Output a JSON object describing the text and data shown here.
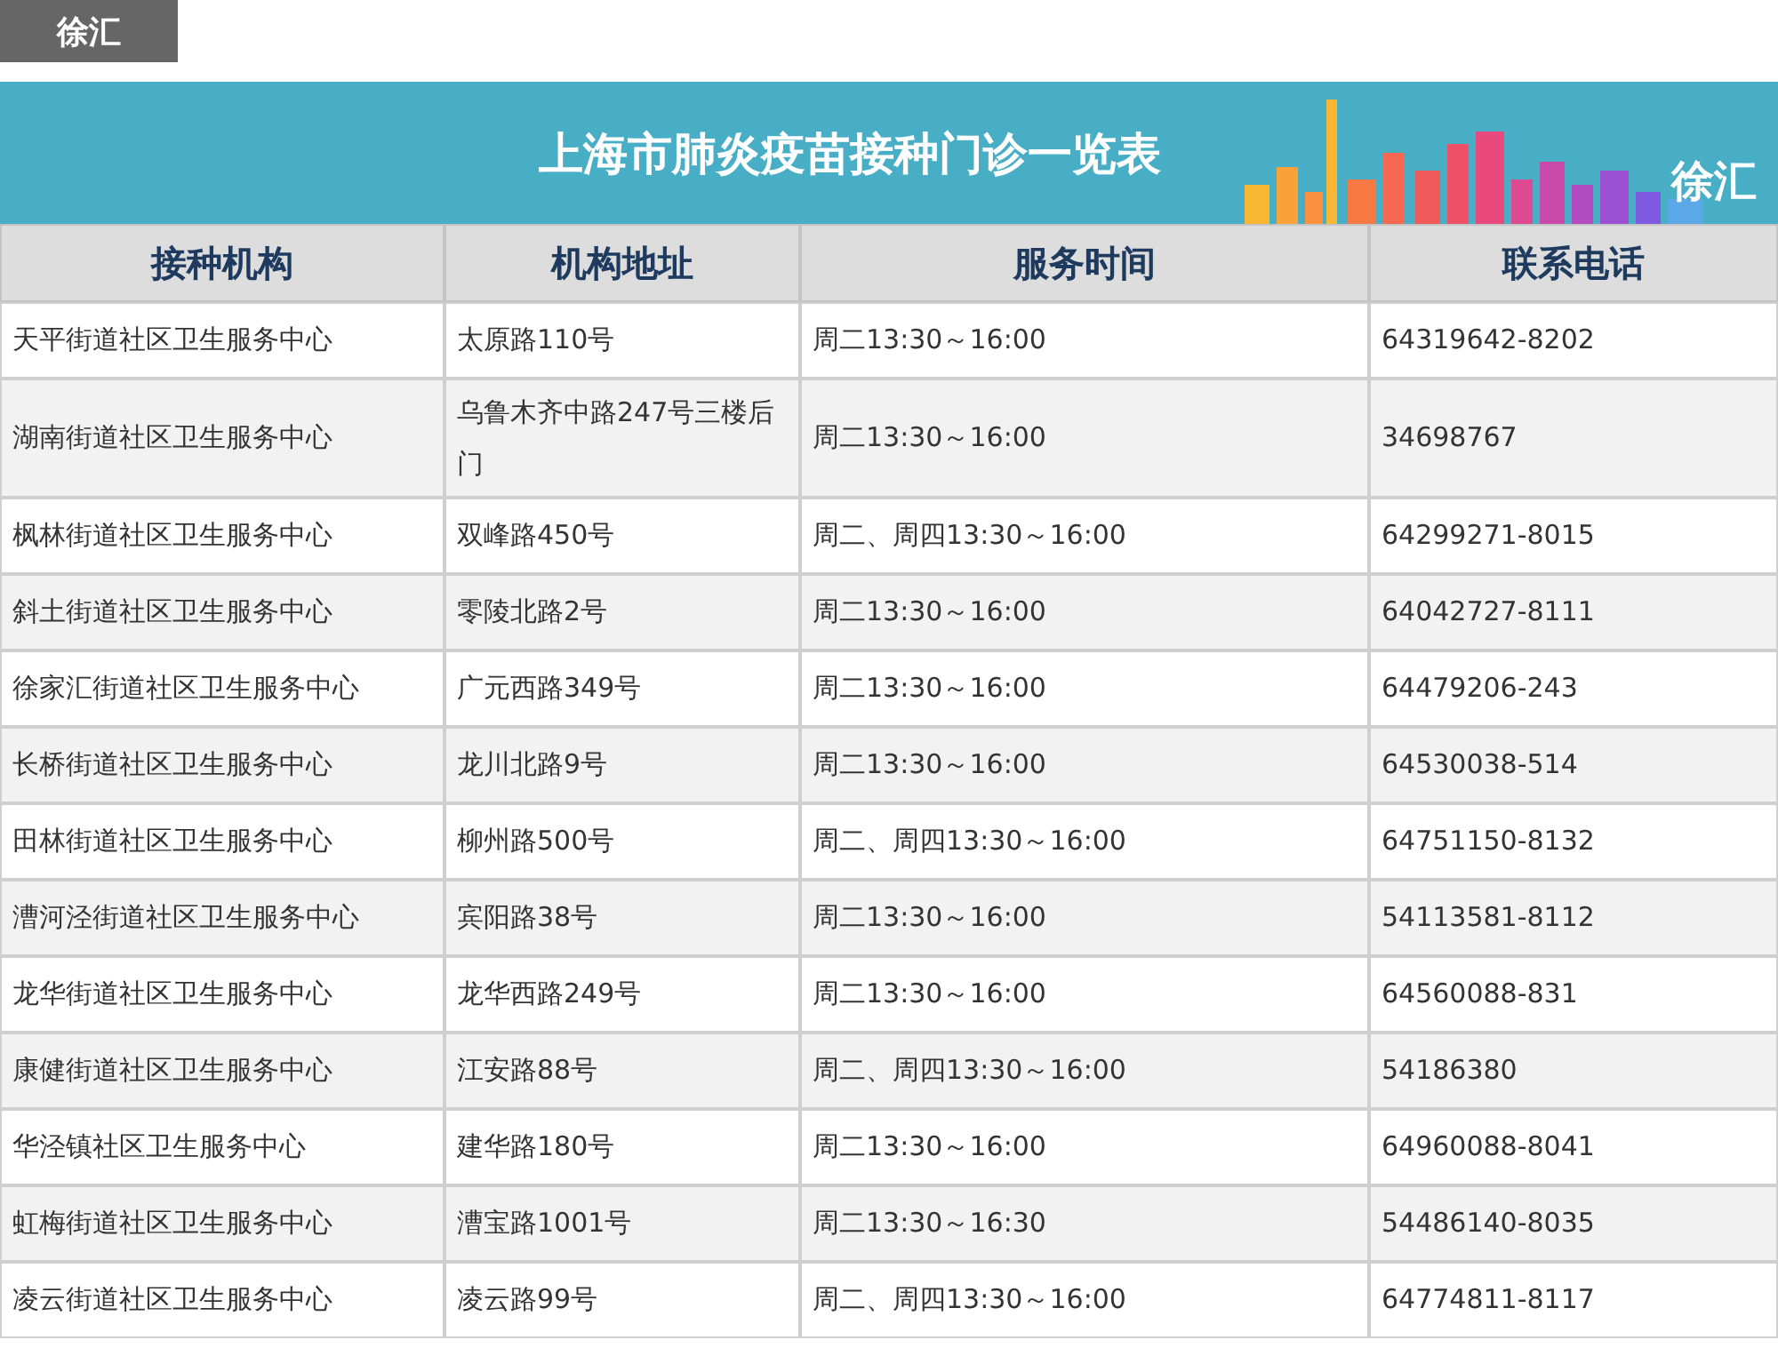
{
  "district_tab": {
    "label": "徐汇",
    "selected": true
  },
  "banner": {
    "title": "上海市肺炎疫苗接种门诊一览表",
    "district": "徐汇"
  },
  "table": {
    "columns": [
      "接种机构",
      "机构地址",
      "服务时间",
      "联系电话"
    ],
    "rows": [
      [
        "天平街道社区卫生服务中心",
        "太原路110号",
        "周二13:30～16:00",
        "64319642-8202"
      ],
      [
        "湖南街道社区卫生服务中心",
        "乌鲁木齐中路247号三楼后门",
        "周二13:30～16:00",
        "34698767"
      ],
      [
        "枫林街道社区卫生服务中心",
        "双峰路450号",
        "周二、周四13:30～16:00",
        "64299271-8015"
      ],
      [
        "斜土街道社区卫生服务中心",
        "零陵北路2号",
        "周二13:30～16:00",
        "64042727-8111"
      ],
      [
        "徐家汇街道社区卫生服务中心",
        "广元西路349号",
        "周二13:30～16:00",
        "64479206-243"
      ],
      [
        "长桥街道社区卫生服务中心",
        "龙川北路9号",
        "周二13:30～16:00",
        "64530038-514"
      ],
      [
        "田林街道社区卫生服务中心",
        "柳州路500号",
        "周二、周四13:30～16:00",
        "64751150-8132"
      ],
      [
        "漕河泾街道社区卫生服务中心",
        "宾阳路38号",
        "周二13:30～16:00",
        "54113581-8112"
      ],
      [
        "龙华街道社区卫生服务中心",
        "龙华西路249号",
        "周二13:30～16:00",
        "64560088-831"
      ],
      [
        "康健街道社区卫生服务中心",
        "江安路88号",
        "周二、周四13:30～16:00",
        "54186380"
      ],
      [
        "华泾镇社区卫生服务中心",
        "建华路180号",
        "周二13:30～16:00",
        "64960088-8041"
      ],
      [
        "虹梅街道社区卫生服务中心",
        "漕宝路1001号",
        "周二13:30～16:30",
        "54486140-8035"
      ],
      [
        "凌云街道社区卫生服务中心",
        "凌云路99号",
        "周二、周四13:30～16:00",
        "64774811-8117"
      ]
    ]
  }
}
